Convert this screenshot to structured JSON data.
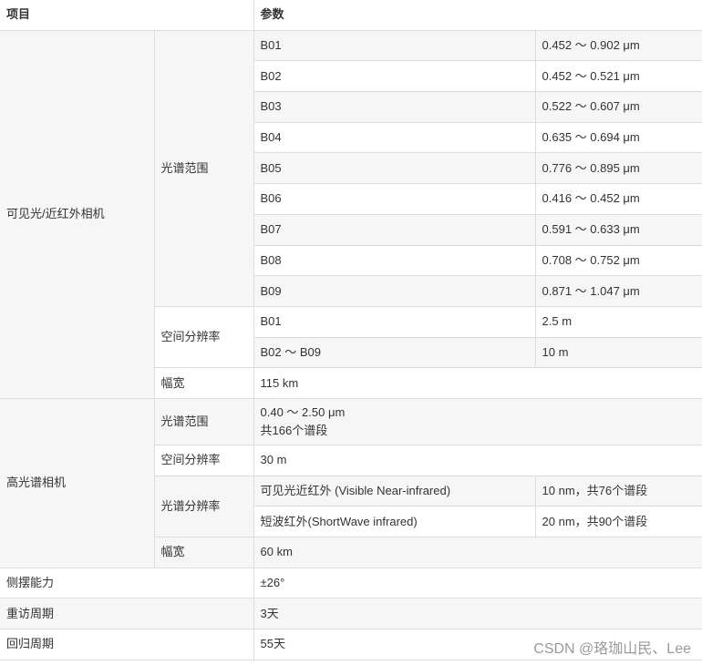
{
  "header": {
    "item": "项目",
    "param": "参数"
  },
  "vnir": {
    "name": "可见光/近红外相机",
    "spectral_label": "光谱范围",
    "bands": [
      [
        "B01",
        "0.452 ～ 0.902 μm"
      ],
      [
        "B02",
        "0.452 ～ 0.521 μm"
      ],
      [
        "B03",
        "0.522 ～ 0.607 μm"
      ],
      [
        "B04",
        "0.635 ～ 0.694 μm"
      ],
      [
        "B05",
        "0.776 ～ 0.895 μm"
      ],
      [
        "B06",
        "0.416 ～ 0.452 μm"
      ],
      [
        "B07",
        "0.591 ～ 0.633 μm"
      ],
      [
        "B08",
        "0.708 ～ 0.752 μm"
      ],
      [
        "B09",
        "0.871 ～ 1.047 μm"
      ]
    ],
    "spatial_label": "空间分辨率",
    "spatial": [
      [
        "B01",
        "2.5 m"
      ],
      [
        "B02 ～ B09",
        "10 m"
      ]
    ],
    "swath_label": "幅宽",
    "swath": "115 km"
  },
  "hyper": {
    "name": "高光谱相机",
    "spectral_label": "光谱范围",
    "spectral_range": "0.40 ～ 2.50 μm",
    "spectral_bands": "共166个谱段",
    "spatial_label": "空间分辨率",
    "spatial": "30 m",
    "specres_label": "光谱分辨率",
    "specres": [
      [
        "可见光近红外 (Visible Near-infrared)",
        "10 nm，共76个谱段"
      ],
      [
        "短波红外(ShortWave infrared)",
        "20 nm，共90个谱段"
      ]
    ],
    "swath_label": "幅宽",
    "swath": "60 km"
  },
  "others": [
    [
      "侧摆能力",
      "±26°"
    ],
    [
      "重访周期",
      "3天"
    ],
    [
      "回归周期",
      "55天"
    ]
  ],
  "watermark": "CSDN @珞珈山民、Lee"
}
